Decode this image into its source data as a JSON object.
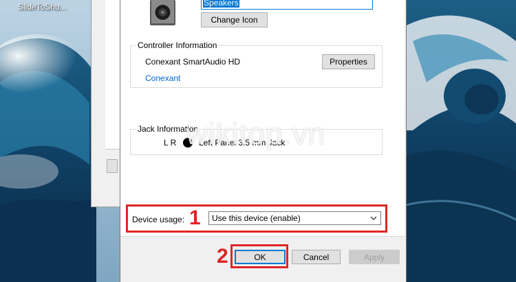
{
  "desktop": {
    "icon_label": "SlideToShu..."
  },
  "dialog": {
    "device_name_value": "Speakers",
    "change_icon_label": "Change Icon",
    "controller": {
      "title": "Controller Information",
      "name": "Conexant SmartAudio HD",
      "properties_label": "Properties",
      "vendor_link": "Conexant"
    },
    "jack": {
      "title": "Jack Information",
      "channels": "L R",
      "description": "Left Panel 3.5 mm Jack"
    },
    "device_usage": {
      "label": "Device usage:",
      "selected": "Use this device (enable)"
    },
    "buttons": {
      "ok": "OK",
      "cancel": "Cancel",
      "apply": "Apply"
    }
  },
  "annotations": {
    "watermark": "wikitop.vn",
    "step1": "1",
    "step2": "2",
    "highlight_color": "#e02424"
  },
  "icons": [
    "speaker-icon",
    "jack-dot-icon",
    "chevron-down-icon"
  ],
  "colors": {
    "accent": "#0078d7",
    "link": "#0066cc"
  }
}
